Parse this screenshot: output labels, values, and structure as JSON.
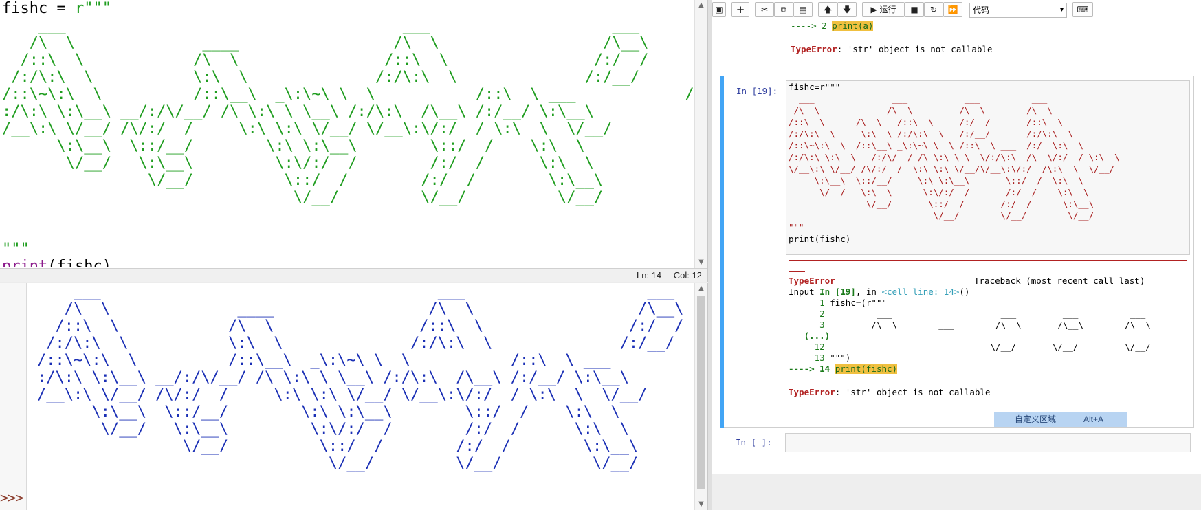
{
  "editor": {
    "code_line1_var": "fishc = ",
    "code_line1_str": "r\"\"\"",
    "ascii_art": "    ___                                     ___                    ___                     ___\n   /\\  \\              ____                 /\\  \\                  /\\__\\                   /\\  \\\n  /::\\  \\            /\\  \\                /::\\  \\                /:/  /                  /::\\  \\\n /:/\\:\\  \\           \\:\\  \\              /:/\\:\\  \\              /:/__/                  /:/\\:\\  \\\n/::\\~\\:\\  \\          /::\\__\\  _\\:\\~\\ \\  \\           /::\\  \\ ___            /:/  \\:\\  \\\n:/\\:\\ \\:\\__\\ __/:/\\/__/ /\\ \\:\\ \\ \\__\\ /:/\\:\\  /\\__\\ /:/__/ \\:\\__\\\n/__\\:\\ \\/__/ /\\/:/  /     \\:\\ \\:\\ \\/__/ \\/__\\:\\/:/  / \\:\\  \\  \\/__/\n      \\:\\__\\  \\::/__/        \\:\\ \\:\\__\\        \\::/  /    \\:\\  \\\n       \\/__/   \\:\\__\\         \\:\\/:/  /        /:/  /      \\:\\  \\\n                \\/__/          \\::/  /        /:/  /        \\:\\__\\\n                                \\/__/         \\/__/          \\/__/",
    "code_close": "\"\"\"",
    "code_print_fn": "print",
    "code_print_args": "(fishc)",
    "status_ln": "Ln: 14",
    "status_col": "Col: 12"
  },
  "shell": {
    "ascii_art": "    ___                                     ___                    ___                     ___\n   /\\  \\              ____                 /\\  \\                  /\\__\\                   /\\  \\\n  /::\\  \\            /\\  \\                /::\\  \\                /:/  /                  /::\\  \\\n /:/\\:\\  \\           \\:\\  \\              /:/\\:\\  \\              /:/__/                  /:/\\:\\  \\\n/::\\~\\:\\  \\          /::\\__\\  _\\:\\~\\ \\  \\           /::\\  \\ ___            /:/  \\:\\  \\\n:/\\:\\ \\:\\__\\ __/:/\\/__/ /\\ \\:\\ \\ \\__\\ /:/\\:\\  /\\__\\ /:/__/ \\:\\__\\\n/__\\:\\ \\/__/ /\\/:/  /     \\:\\ \\:\\ \\/__/ \\/__\\:\\/:/  / \\:\\  \\  \\/__/\n      \\:\\__\\  \\::/__/        \\:\\ \\:\\__\\        \\::/  /    \\:\\  \\\n       \\/__/   \\:\\__\\         \\:\\/:/  /        /:/  /      \\:\\  \\\n                \\/__/          \\::/  /        /:/  /        \\:\\__\\\n                                \\/__/         \\/__/          \\/__/",
    "prompt": ">>>"
  },
  "notebook": {
    "toolbar": {
      "run_label": "运行",
      "cell_type": "代码"
    },
    "prev_output": {
      "arrow_line_prefix": "----> 2 ",
      "arrow_line_code": "print(a)",
      "error_name": "TypeError",
      "error_msg": ": 'str' object is not callable"
    },
    "cell": {
      "prompt": "In  [19]:",
      "source_line1": "fishc=r\"\"\"",
      "ascii_art": "  ___               ___           ___          ___\n /\\  \\             /\\  \\         /\\__\\        /\\  \\\n/::\\  \\      /\\  \\   /::\\  \\     /:/  /       /::\\  \\\n/:/\\:\\  \\     \\:\\  \\ /:/\\:\\  \\   /:/__/       /:/\\:\\  \\\n/::\\~\\:\\  \\  /::\\__\\ _\\:\\~\\ \\  \\ /::\\  \\ ___  /:/  \\:\\  \\\n/:/\\:\\ \\:\\__\\ __/:/\\/__/ /\\ \\:\\ \\ \\__\\/:/\\:\\  /\\__\\/:/__/ \\:\\__\\\n\\/__\\:\\ \\/__/ /\\/:/  /  \\:\\ \\:\\ \\/__/\\/__\\:\\/:/  /\\:\\  \\  \\/__/\n     \\:\\__\\  \\::/__/     \\:\\ \\:\\__\\       \\::/  /  \\:\\  \\\n      \\/__/   \\:\\__\\      \\:\\/:/  /       /:/  /    \\:\\  \\\n               \\/__/       \\::/  /       /:/  /      \\:\\__\\\n                            \\/__/        \\/__/        \\/__/",
      "source_close": "\"\"\"",
      "source_print": "print(fishc)"
    },
    "traceback": {
      "dashes": "---------------------------------------------------------------------------",
      "dashes2": "----",
      "error_name": "TypeError",
      "traceback_hdr": "Traceback (most recent call last)",
      "input_prefix": "Input ",
      "input_in": "In [19]",
      "input_mid": ", in ",
      "input_cell": "<cell line: 14>",
      "input_paren": "()",
      "l1_no": "      1 ",
      "l1_code": "fishc=(r\"\"\"",
      "l2_no": "      2 ",
      "l2_code": "         ___                     ___         ___          ___",
      "l3_no": "      3 ",
      "l3_code": "        /\\  \\        ___        /\\  \\       /\\__\\        /\\  \\",
      "ellipsis": "   (...)",
      "l12_no": "     12 ",
      "l12_code": "                               \\/__/       \\/__/         \\/__/",
      "l13_no": "     13 ",
      "l13_code": "\"\"\")",
      "l14_arrow": "----> 14 ",
      "l14_code": "print(fishc)",
      "error_name2": "TypeError",
      "error_msg2": ": 'str' object is not callable"
    },
    "custom_region": {
      "label": "自定义区域",
      "shortcut": "Alt+A"
    },
    "new_cell": {
      "prompt": "In  [ ]:"
    }
  }
}
